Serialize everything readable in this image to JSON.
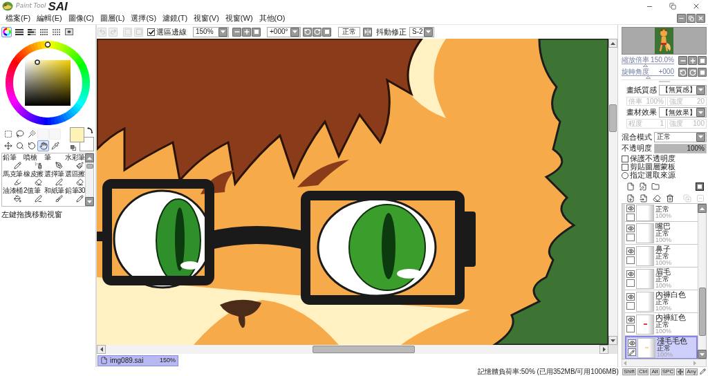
{
  "window": {
    "logo_small": "Paint Tool",
    "logo": "SAI"
  },
  "menu": [
    "檔案(F)",
    "編輯(E)",
    "圖像(C)",
    "圖層(L)",
    "選擇(S)",
    "濾鏡(T)",
    "視窗(V)",
    "視窗(W)",
    "其他(O)"
  ],
  "color_panels": [
    {
      "kind": "wheel",
      "selected": true
    },
    {
      "kind": "rgb",
      "selected": false
    },
    {
      "kind": "hsv",
      "selected": false
    },
    {
      "kind": "swatches",
      "selected": false
    },
    {
      "kind": "grid",
      "selected": false
    },
    {
      "kind": "scratchpad",
      "selected": false
    }
  ],
  "toolbar": {
    "buttons": [
      {
        "kind": "undo",
        "disabled": true
      },
      {
        "kind": "redo",
        "disabled": true
      },
      {
        "kind": "deselect",
        "disabled": true
      },
      {
        "kind": "invert",
        "disabled": true
      }
    ],
    "selection_edge": {
      "label": "選區邊線",
      "checked": true
    },
    "zoom": "150%",
    "rotation": "+000°",
    "blend_button": "正常",
    "stabilizer_label": "抖動修正",
    "stabilizer": "S-2"
  },
  "tools": [
    {
      "kind": "rect-select",
      "selected": false
    },
    {
      "kind": "lasso",
      "selected": false
    },
    {
      "kind": "magic-wand",
      "selected": false
    },
    {
      "kind": "empty",
      "selected": false
    },
    {
      "kind": "empty",
      "selected": false
    },
    {
      "kind": "move",
      "selected": false
    },
    {
      "kind": "zoom",
      "selected": false
    },
    {
      "kind": "rotate",
      "selected": false
    },
    {
      "kind": "hand",
      "selected": true
    },
    {
      "kind": "eyedropper",
      "selected": false
    }
  ],
  "color_swatches": [
    {
      "kind": "foreground",
      "color": "#fdf3b7"
    },
    {
      "kind": "background",
      "color": "#ffffff"
    }
  ],
  "brushes": [
    {
      "name": "鉛筆",
      "kind": "pencil"
    },
    {
      "name": "噴槍",
      "kind": "airbrush"
    },
    {
      "name": "筆",
      "kind": "pen"
    },
    {
      "name": "水彩筆",
      "kind": "watercolor"
    },
    {
      "name": "馬克筆",
      "kind": "marker"
    },
    {
      "name": "橡皮擦",
      "kind": "eraser"
    },
    {
      "name": "選擇筆",
      "kind": "select-pen"
    },
    {
      "name": "選區擦",
      "kind": "select-eraser"
    },
    {
      "name": "油漆桶",
      "kind": "bucket"
    },
    {
      "name": "2值筆",
      "kind": "binary-pen"
    },
    {
      "name": "和紙筆",
      "kind": "washi-pen"
    },
    {
      "name": "鉛筆30",
      "kind": "pencil"
    }
  ],
  "hint": "左鍵拖拽移動視窗",
  "documents": [
    {
      "name": "img089.sai",
      "zoom": "150%",
      "selected": true
    }
  ],
  "navigator": {
    "zoom": {
      "label": "縮放倍率",
      "value": "150.0%",
      "level": 0.45
    },
    "rotation": {
      "label": "旋轉角度",
      "value": "+000",
      "level": 0.5
    }
  },
  "paper_texture": {
    "label": "畫紙質感",
    "value": "【無質感】",
    "fields": [
      {
        "label": "倍率",
        "value": "100%"
      },
      {
        "label": "強度",
        "value": "20"
      }
    ],
    "disabled": true
  },
  "brush_effect": {
    "label": "畫材效果",
    "value": "【無效果】",
    "fields": [
      {
        "label": "程度",
        "value": "1"
      },
      {
        "label": "強度",
        "value": "100"
      }
    ],
    "disabled": true
  },
  "blend_mode": {
    "label": "混合模式",
    "value": "正常"
  },
  "opacity": {
    "label": "不透明度",
    "value": "100%",
    "level": 1
  },
  "layer_options": [
    {
      "kind": "checkbox",
      "label": "保護不透明度",
      "checked": false
    },
    {
      "kind": "checkbox",
      "label": "剪貼圖層蒙板",
      "checked": false
    },
    {
      "kind": "radio",
      "label": "指定選取來源",
      "checked": false
    }
  ],
  "layer_tools": [
    {
      "kind": "new-layer",
      "disabled": false
    },
    {
      "kind": "new-pen-layer",
      "disabled": false
    },
    {
      "kind": "new-folder",
      "disabled": false
    },
    {
      "kind": "mask",
      "disabled": false
    },
    {
      "kind": "transfer-down",
      "disabled": false
    },
    {
      "kind": "merge-down",
      "disabled": false
    },
    {
      "kind": "clear",
      "disabled": false
    },
    {
      "kind": "delete",
      "disabled": false
    },
    {
      "kind": "add-mask",
      "disabled": true
    },
    {
      "kind": "apply-mask",
      "disabled": true
    }
  ],
  "layers": [
    {
      "mode": "正常",
      "opacity": "100%",
      "visible": true,
      "selected": false
    },
    {
      "name": "嘴巴",
      "mode": "正常",
      "opacity": "100%",
      "visible": true,
      "selected": false
    },
    {
      "name": "鼻子",
      "mode": "正常",
      "opacity": "100%",
      "visible": true,
      "selected": false
    },
    {
      "name": "眉毛",
      "mode": "正常",
      "opacity": "100%",
      "visible": true,
      "selected": false
    },
    {
      "name": "內褲白色",
      "mode": "正常",
      "opacity": "100%",
      "visible": true,
      "selected": false
    },
    {
      "name": "內褲紅色",
      "mode": "正常",
      "opacity": "100%",
      "visible": true,
      "selected": false,
      "color": "#e23a3a"
    },
    {
      "name": "淺毛毛色",
      "mode": "正常",
      "opacity": "100%",
      "visible": true,
      "selected": true,
      "color": "#f2d98f"
    }
  ],
  "status_bar": {
    "memory": "記憶體負荷率:50% (已用352MB/可用1006MB)",
    "keys": [
      {
        "kind": "text",
        "label": "Shift"
      },
      {
        "kind": "text",
        "label": "Ctrl"
      },
      {
        "kind": "text",
        "label": "Alt"
      },
      {
        "kind": "text",
        "label": "SPC"
      },
      {
        "kind": "move"
      },
      {
        "kind": "text",
        "label": "Any"
      },
      {
        "kind": "pen"
      }
    ]
  }
}
